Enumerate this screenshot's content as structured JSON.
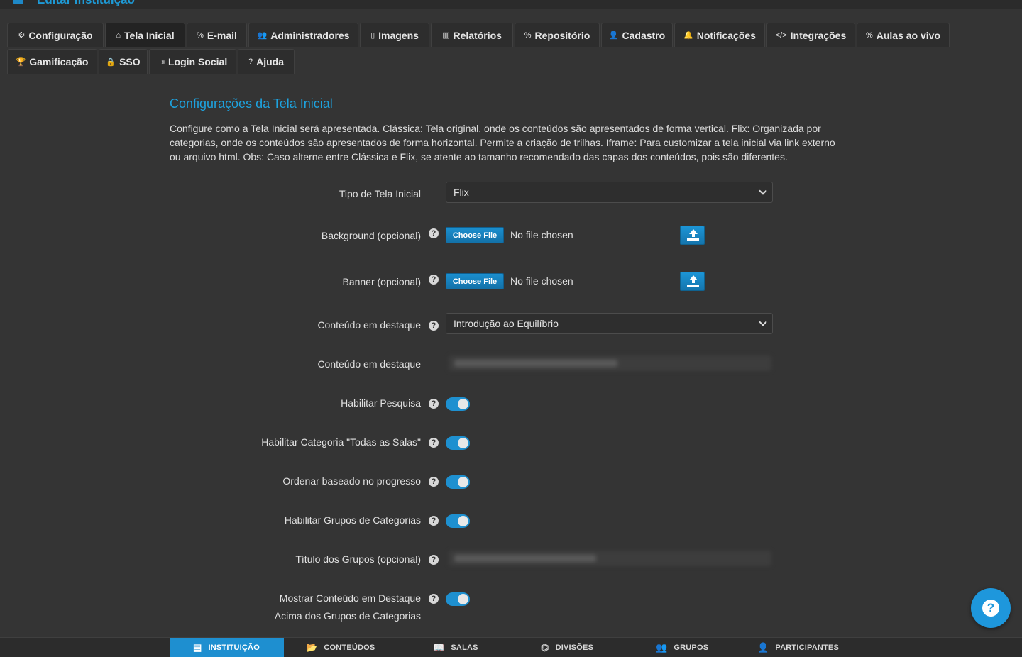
{
  "header": {
    "title": "Editar Instituição"
  },
  "tabs": [
    {
      "label": "Configuração",
      "icon": "gears-icon",
      "glyph": "⚙"
    },
    {
      "label": "Tela Inicial",
      "icon": "home-icon",
      "glyph": "⌂"
    },
    {
      "label": "E-mail",
      "icon": "link-icon",
      "glyph": "%"
    },
    {
      "label": "Administradores",
      "icon": "users-icon",
      "glyph": "👥"
    },
    {
      "label": "Imagens",
      "icon": "file-icon",
      "glyph": "▯"
    },
    {
      "label": "Relatórios",
      "icon": "bar-chart-icon",
      "glyph": "▥"
    },
    {
      "label": "Repositório",
      "icon": "link-icon",
      "glyph": "%"
    },
    {
      "label": "Cadastro",
      "icon": "user-icon",
      "glyph": "👤"
    },
    {
      "label": "Notificações",
      "icon": "bell-icon",
      "glyph": "🔔"
    },
    {
      "label": "Integrações",
      "icon": "code-icon",
      "glyph": "</>"
    },
    {
      "label": "Aulas ao vivo",
      "icon": "link-icon",
      "glyph": "%"
    },
    {
      "label": "Gamificação",
      "icon": "trophy-icon",
      "glyph": "🏆"
    },
    {
      "label": "SSO",
      "icon": "lock-icon",
      "glyph": "🔒"
    },
    {
      "label": "Login Social",
      "icon": "sign-in-icon",
      "glyph": "⇥"
    },
    {
      "label": "Ajuda",
      "icon": "question-circle-icon",
      "glyph": "?"
    }
  ],
  "active_tab": "Tela Inicial",
  "section": {
    "title": "Configurações da Tela Inicial",
    "description": "Configure como a Tela Inicial será apresentada. Clássica: Tela original, onde os conteúdos são apresentados de forma vertical. Flix: Organizada por categorias, onde os conteúdos são apresentados de forma horizontal. Permite a criação de trilhas. Iframe: Para customizar a tela inicial via link externo ou arquivo html. Obs: Caso alterne entre Clássica e Flix, se atente ao tamanho recomendado das capas dos conteúdos, pois são diferentes."
  },
  "form": {
    "tipo": {
      "label": "Tipo de Tela Inicial",
      "value": "Flix"
    },
    "background": {
      "label": "Background (opcional)",
      "button": "Choose File",
      "status": "No file chosen"
    },
    "banner": {
      "label": "Banner (opcional)",
      "button": "Choose File",
      "status": "No file chosen"
    },
    "destaque": {
      "label": "Conteúdo em destaque",
      "value": "Introdução ao Equilíbrio"
    },
    "destaque2": {
      "label": "Conteúdo em destaque"
    },
    "pesquisa": {
      "label": "Habilitar Pesquisa",
      "enabled": true
    },
    "todas_salas": {
      "label": "Habilitar Categoria \"Todas as Salas\"",
      "enabled": true
    },
    "ordenar": {
      "label": "Ordenar baseado no progresso",
      "enabled": true
    },
    "grupos": {
      "label": "Habilitar Grupos de Categorias",
      "enabled": true
    },
    "titulo_grupos": {
      "label": "Título dos Grupos (opcional)"
    },
    "mostrar": {
      "label_line1": "Mostrar Conteúdo em Destaque",
      "label_line2": "Acima dos Grupos de Categorias",
      "enabled": true
    }
  },
  "help_glyph": "?",
  "bottom_nav": [
    {
      "label": "INSTITUIÇÃO",
      "icon": "building-icon",
      "glyph": "▤",
      "active": true
    },
    {
      "label": "CONTEÚDOS",
      "icon": "folder-open-icon",
      "glyph": "📂"
    },
    {
      "label": "SALAS",
      "icon": "book-icon",
      "glyph": "📖"
    },
    {
      "label": "DIVISÕES",
      "icon": "sitemap-icon",
      "glyph": "⌬"
    },
    {
      "label": "GRUPOS",
      "icon": "users-icon",
      "glyph": "👥"
    },
    {
      "label": "PARTICIPANTES",
      "icon": "user-icon",
      "glyph": "👤"
    }
  ],
  "colors": {
    "accent": "#1e97dc",
    "background": "#343434",
    "tab_bg": "#2d2d2d"
  }
}
